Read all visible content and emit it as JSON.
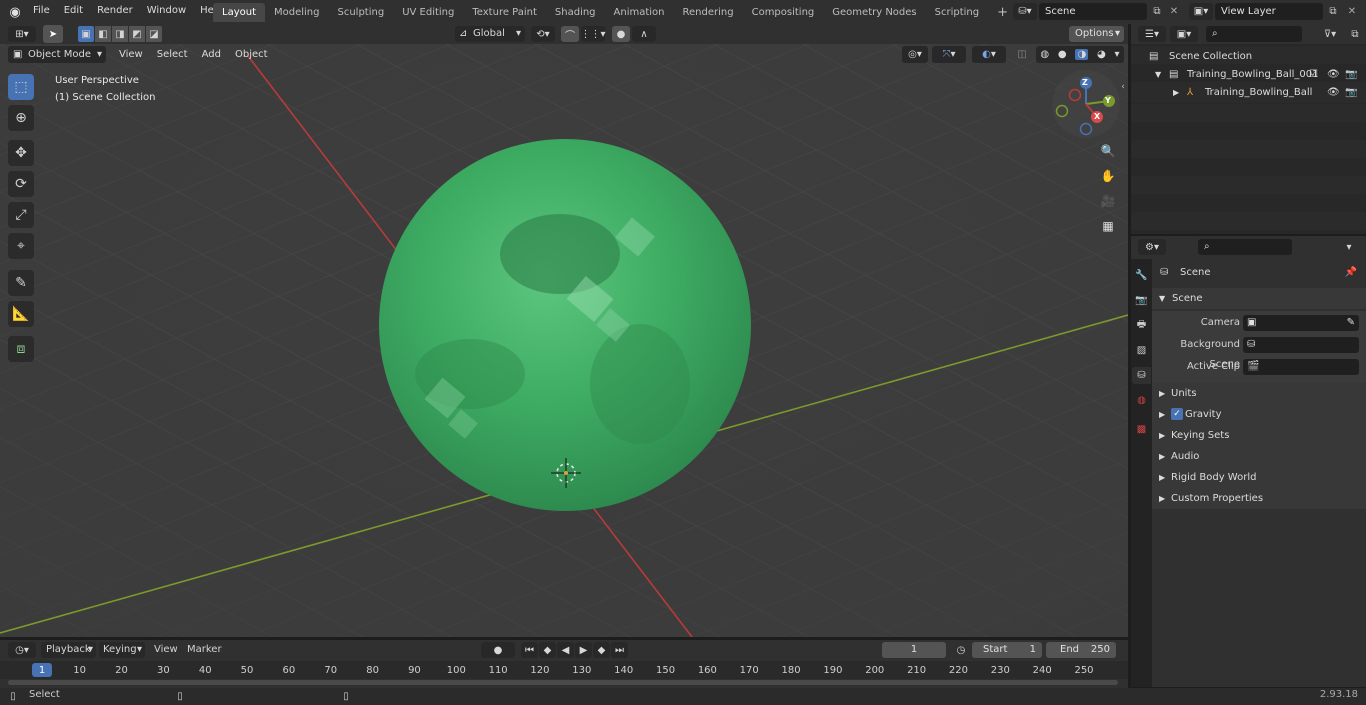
{
  "topbar": {
    "menus": [
      "File",
      "Edit",
      "Render",
      "Window",
      "Help"
    ],
    "workspaces": [
      "Layout",
      "Modeling",
      "Sculpting",
      "UV Editing",
      "Texture Paint",
      "Shading",
      "Animation",
      "Rendering",
      "Compositing",
      "Geometry Nodes",
      "Scripting"
    ],
    "add_tab": "+",
    "scene_name": "Scene",
    "view_layer": "View Layer"
  },
  "viewport_header": {
    "mode": "Object Mode",
    "menus": [
      "View",
      "Select",
      "Add",
      "Object"
    ],
    "orientation": "Global",
    "options": "Options"
  },
  "viewport": {
    "overlay_line1": "User Perspective",
    "overlay_line2": "(1) Scene Collection",
    "axis_x": "X",
    "axis_y": "Y",
    "axis_z": "Z"
  },
  "outliner": {
    "root": "Scene Collection",
    "items": [
      {
        "label": "Training_Bowling_Ball_001"
      },
      {
        "label": "Training_Bowling_Ball"
      }
    ]
  },
  "properties": {
    "context": "Scene",
    "section": "Scene",
    "fields": [
      {
        "label": "Camera"
      },
      {
        "label": "Background Scene"
      },
      {
        "label": "Active Clip"
      }
    ],
    "panels": [
      "Units",
      "Gravity",
      "Keying Sets",
      "Audio",
      "Rigid Body World",
      "Custom Properties"
    ]
  },
  "timeline": {
    "menus": [
      "Playback",
      "Keying",
      "View",
      "Marker"
    ],
    "current_frame": "1",
    "start_label": "Start",
    "start_value": "1",
    "end_label": "End",
    "end_value": "250",
    "ticks": [
      "1",
      "10",
      "20",
      "30",
      "40",
      "50",
      "60",
      "70",
      "80",
      "90",
      "100",
      "110",
      "120",
      "130",
      "140",
      "150",
      "160",
      "170",
      "180",
      "190",
      "200",
      "210",
      "220",
      "230",
      "240",
      "250"
    ]
  },
  "statusbar": {
    "left": "Select",
    "version": "2.93.18"
  },
  "colors": {
    "ball": "#3dab62",
    "x_axis": "#b83b3b",
    "y_axis": "#7b9a2c",
    "accent": "#4772b3"
  }
}
